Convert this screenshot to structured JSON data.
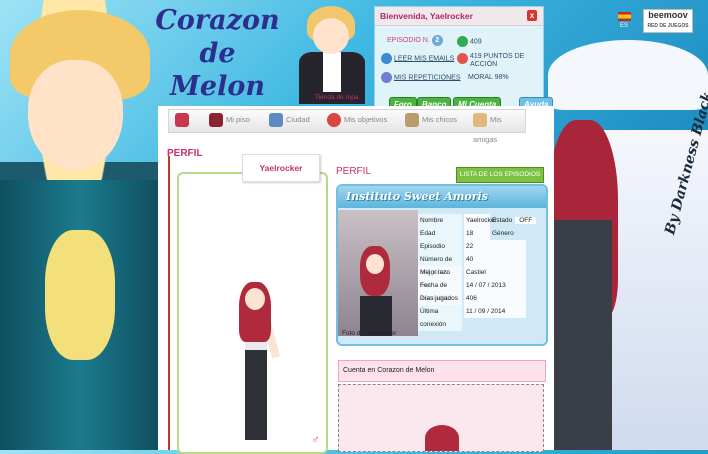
{
  "logo": {
    "line1": "Corazon",
    "line2": "de",
    "line3": "Melon"
  },
  "signature": "By Darkness Black",
  "header": {
    "welcome": "Bienvenida, Yaelrocker",
    "close": "x",
    "episode_label": "EPISODIO N.",
    "episode_number": "2",
    "points": "409",
    "emails": "LEER MIS EMAILS",
    "action_points": "419 PUNTOS DE ACCIÓN",
    "repetitions": "MIS REPETICIONES",
    "morale": "MORAL 98%",
    "menu": [
      "Foro",
      "Banco",
      "Mi Cuenta",
      "Ayuda"
    ],
    "shop_label": "Tienda de ropa"
  },
  "lang": "ES",
  "partner": {
    "name": "beemoov",
    "sub": "RED DE JUEGOS"
  },
  "nav": [
    "",
    "Mi piso",
    "Ciudad",
    "Mis objetivos",
    "Mis chicos",
    "Mis amigas"
  ],
  "perfil_heading": "PERFIL",
  "username_tag": "Yaelrocker",
  "perfil_right": "PERFIL",
  "lista_button": "LISTA DE LOS EPISODIOS",
  "card": {
    "title": "Instituto Sweet Amoris",
    "caption": "Foto de Yaelrocker",
    "rows": [
      {
        "k": "Nombre",
        "v": "Yaelrocker"
      },
      {
        "k": "Edad",
        "v": "18"
      },
      {
        "k": "Episodio",
        "v": "22"
      },
      {
        "k": "Número de imágenes",
        "v": "40"
      },
      {
        "k": "Mejor lazo con",
        "v": "Castiel"
      },
      {
        "k": "Fecha de inscripción",
        "v": "14 / 07 / 2013"
      },
      {
        "k": "Días jugados",
        "v": "406"
      },
      {
        "k": "Última conexión",
        "v": "11 / 09 / 2014"
      }
    ],
    "estado_label": "Estado",
    "estado_value": "OFF",
    "genero_label": "Género"
  },
  "cuenta": "Cuenta en Corazon de Melon",
  "colors": {
    "accent": "#c8316d",
    "green": "#4bb341",
    "blue": "#72bfe0"
  }
}
